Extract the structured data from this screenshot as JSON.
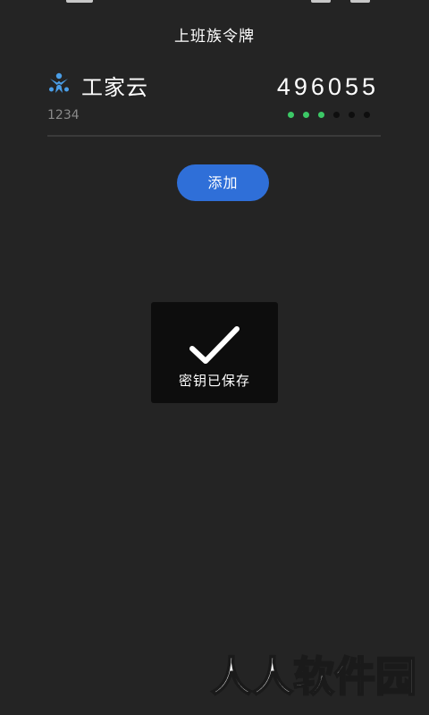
{
  "header": {
    "title": "上班族令牌"
  },
  "token": {
    "icon": "person-group-logo-icon",
    "name": "工家云",
    "account": "1234",
    "code": "496055",
    "countdown_total": 6,
    "countdown_remaining": 3,
    "countdown_active_color": "#3cc866"
  },
  "actions": {
    "add_label": "添加",
    "add_color": "#2f6fd8"
  },
  "toast": {
    "icon": "checkmark-icon",
    "message": "密钥已保存"
  },
  "watermark": {
    "text": "人人软件园"
  }
}
